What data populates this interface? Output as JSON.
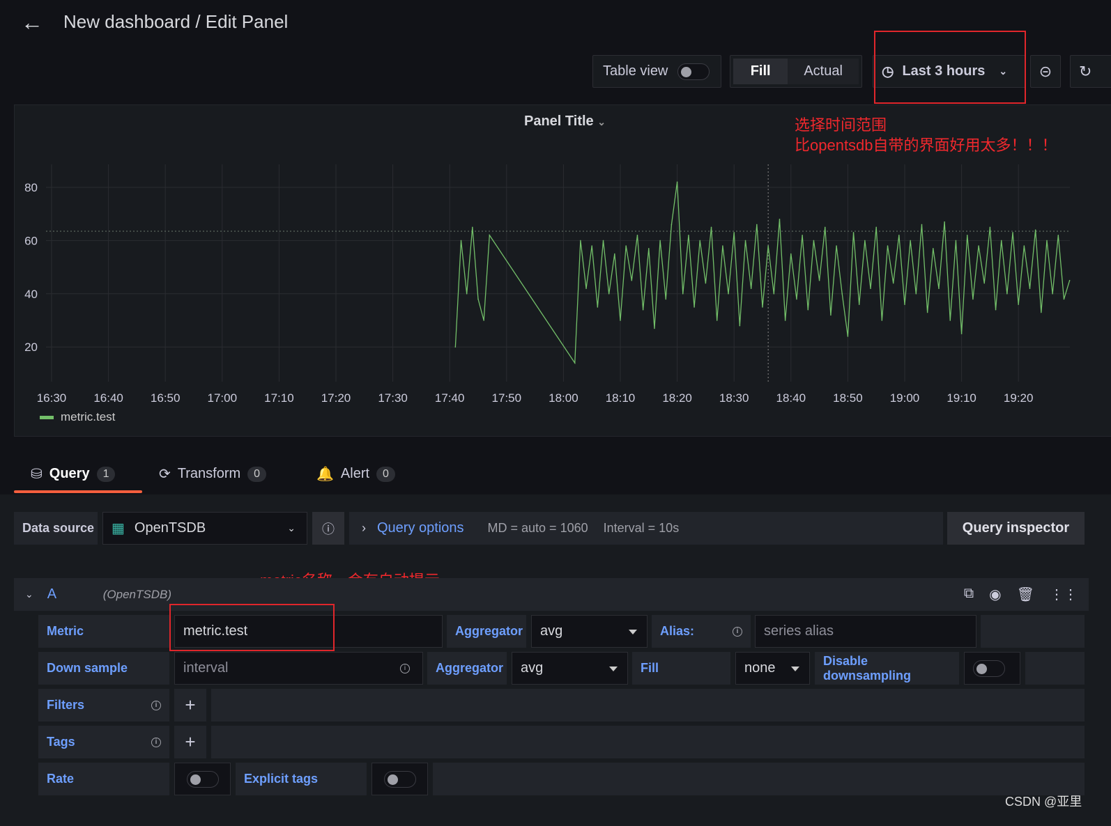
{
  "header": {
    "title": "New dashboard / Edit Panel",
    "back_icon": "arrow-left-icon"
  },
  "toolbar": {
    "table_view": "Table view",
    "table_view_on": false,
    "fill": "Fill",
    "actual": "Actual",
    "fill_selected": "Fill",
    "time_range": "Last 3 hours"
  },
  "annotations": {
    "time_note_1": "选择时间范围",
    "time_note_2": "比opentsdb自带的界面好用太多！！！",
    "metric_note": "metric名称，会有自动提示",
    "watermark": "CSDN @亚里"
  },
  "panel": {
    "title": "Panel Title",
    "legend": "metric.test"
  },
  "chart_data": {
    "type": "line",
    "xlabel": "",
    "ylabel": "",
    "x_ticks": [
      "16:30",
      "16:40",
      "16:50",
      "17:00",
      "17:10",
      "17:20",
      "17:30",
      "17:40",
      "17:50",
      "18:00",
      "18:10",
      "18:20",
      "18:30",
      "18:40",
      "18:50",
      "19:00",
      "19:10",
      "19:20"
    ],
    "y_ticks": [
      20,
      40,
      60,
      80
    ],
    "ylim": [
      7,
      88
    ],
    "grid": true,
    "legend": "bottom-left",
    "threshold_line": 63.5,
    "crosshair": "18:36",
    "series": [
      {
        "name": "metric.test",
        "color": "#73bf69",
        "x": [
          "17:41",
          "17:42",
          "17:43",
          "17:44",
          "17:45",
          "17:46",
          "17:47",
          "18:02",
          "18:03",
          "18:04",
          "18:05",
          "18:06",
          "18:07",
          "18:08",
          "18:09",
          "18:10",
          "18:11",
          "18:12",
          "18:13",
          "18:14",
          "18:15",
          "18:16",
          "18:17",
          "18:18",
          "18:19",
          "18:20",
          "18:21",
          "18:22",
          "18:23",
          "18:24",
          "18:25",
          "18:26",
          "18:27",
          "18:28",
          "18:29",
          "18:30",
          "18:31",
          "18:32",
          "18:33",
          "18:34",
          "18:35",
          "18:36",
          "18:37",
          "18:38",
          "18:39",
          "18:40",
          "18:41",
          "18:42",
          "18:43",
          "18:44",
          "18:45",
          "18:46",
          "18:47",
          "18:48",
          "18:49",
          "18:50",
          "18:51",
          "18:52",
          "18:53",
          "18:54",
          "18:55",
          "18:56",
          "18:57",
          "18:58",
          "18:59",
          "19:00",
          "19:01",
          "19:02",
          "19:03",
          "19:04",
          "19:05",
          "19:06",
          "19:07",
          "19:08",
          "19:09",
          "19:10",
          "19:11",
          "19:12",
          "19:13",
          "19:14",
          "19:15",
          "19:16",
          "19:17",
          "19:18",
          "19:19",
          "19:20",
          "19:21",
          "19:22",
          "19:23",
          "19:24",
          "19:25",
          "19:26",
          "19:27",
          "19:28",
          "19:29"
        ],
        "y": [
          20,
          60,
          40,
          65,
          38,
          30,
          62,
          14,
          60,
          42,
          58,
          35,
          60,
          40,
          55,
          30,
          58,
          45,
          62,
          34,
          57,
          27,
          60,
          38,
          66,
          82,
          40,
          62,
          35,
          60,
          44,
          65,
          30,
          58,
          40,
          63,
          28,
          60,
          42,
          66,
          35,
          58,
          40,
          68,
          30,
          55,
          38,
          62,
          34,
          60,
          45,
          65,
          32,
          58,
          40,
          24,
          63,
          36,
          60,
          42,
          65,
          30,
          58,
          44,
          62,
          36,
          60,
          40,
          66,
          33,
          57,
          42,
          67,
          30,
          60,
          25,
          62,
          38,
          58,
          44,
          65,
          34,
          60,
          40,
          63,
          36,
          58,
          42,
          64,
          33,
          60,
          40,
          62,
          38,
          45
        ]
      }
    ]
  },
  "tabs": [
    {
      "label": "Query",
      "count": "1",
      "icon": "database-icon"
    },
    {
      "label": "Transform",
      "count": "0",
      "icon": "transform-icon"
    },
    {
      "label": "Alert",
      "count": "0",
      "icon": "bell-icon"
    }
  ],
  "query_bar": {
    "data_source_label": "Data source",
    "data_source": "OpenTSDB",
    "query_options": "Query options",
    "md": "MD = auto = 1060",
    "interval": "Interval = 10s",
    "inspector": "Query inspector"
  },
  "query": {
    "ref": "A",
    "ds": "(OpenTSDB)",
    "metric_label": "Metric",
    "metric_value": "metric.test",
    "aggregator_label": "Aggregator",
    "aggregator": "avg",
    "alias_label": "Alias:",
    "alias_placeholder": "series alias",
    "downsample_label": "Down sample",
    "downsample_placeholder": "interval",
    "ds_aggregator": "avg",
    "fill_label": "Fill",
    "fill_value": "none",
    "disable_label": "Disable downsampling",
    "filters_label": "Filters",
    "tags_label": "Tags",
    "rate_label": "Rate",
    "explicit_label": "Explicit tags"
  }
}
